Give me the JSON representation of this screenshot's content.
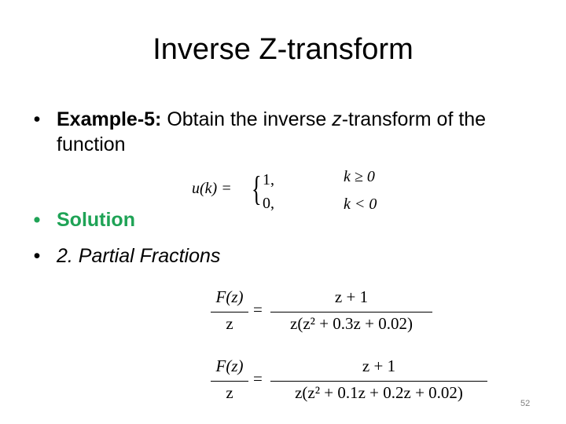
{
  "slide": {
    "title": "Inverse Z-transform",
    "page_number": "52",
    "accent_color": "#1fa356"
  },
  "bullets": [
    {
      "bullet": "•",
      "label_bold": "Example-5:",
      "text_before_italic": " Obtain the inverse ",
      "italic_var": "z",
      "text_after_italic": "-transform of the function"
    },
    {
      "bullet": "•",
      "text": "Solution"
    },
    {
      "bullet": "•",
      "text": "2. Partial Fractions"
    }
  ],
  "piecewise": {
    "lhs": "u(k) =",
    "brace": "{",
    "cases": [
      {
        "value": "1,",
        "condition": "k ≥ 0"
      },
      {
        "value": "0,",
        "condition": "k < 0"
      }
    ]
  },
  "equations": [
    {
      "lhs_num": "F(z)",
      "lhs_den": "z",
      "eq": "=",
      "rhs_num": "z + 1",
      "rhs_den": "z(z² + 0.3z + 0.02)"
    },
    {
      "lhs_num": "F(z)",
      "lhs_den": "z",
      "eq": "=",
      "rhs_num": "z + 1",
      "rhs_den": "z(z² + 0.1z + 0.2z + 0.02)"
    }
  ]
}
